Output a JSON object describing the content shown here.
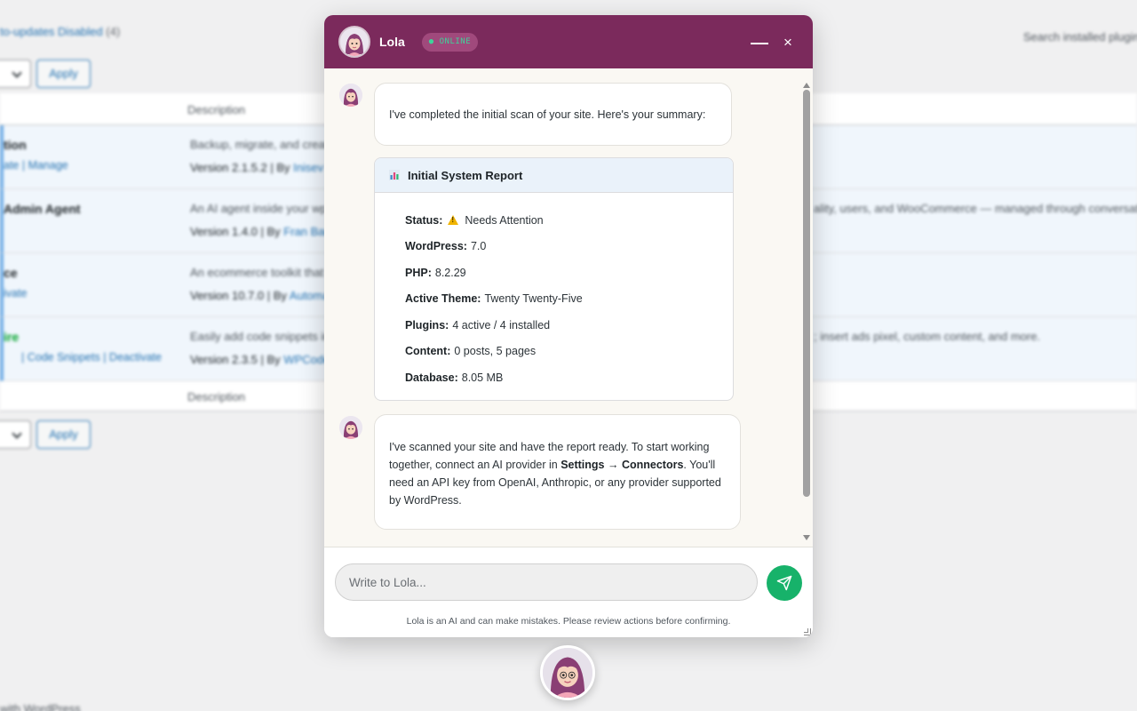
{
  "background": {
    "auto_updates": "to-updates Disabled",
    "auto_updates_count": "(4)",
    "search_label": "Search installed plugins",
    "apply_label": "Apply",
    "column_description": "Description",
    "rows": [
      {
        "name": "tion",
        "actions": "ate | Manage",
        "description": "Backup, migrate, and create",
        "version": "Version 2.1.5.2 | By",
        "author": "Inisev"
      },
      {
        "name": "Admin Agent",
        "actions": "",
        "description": "An AI agent inside your wp",
        "description_tail": "ality, users, and WooCommerce — managed through conversatio",
        "version": "Version 1.4.0 | By",
        "author": "Fran Barbe"
      },
      {
        "name": "ce",
        "actions": "ivate",
        "description": "An ecommerce toolkit that",
        "version": "Version 10.7.0 | By",
        "author": "Automat"
      },
      {
        "name": "ire",
        "actions": " | Code Snippets | Deactivate",
        "description": "Easily add code snippets in",
        "description_tail": "; insert ads pixel, custom content, and more.",
        "version": "Version 2.3.5 | By",
        "author": "WPCode"
      }
    ],
    "footer": "with WordPress"
  },
  "chat": {
    "agent_name": "Lola",
    "status": "● ONLINE",
    "minimize_icon": "minimize-icon",
    "close_label": "×",
    "messages": {
      "intro": "I've completed the initial scan of your site. Here's your summary:",
      "report": {
        "title": "Initial System Report",
        "icon": "bar-chart-icon",
        "items": [
          {
            "label": "Status:",
            "value": "Needs Attention",
            "icon": "warning-icon"
          },
          {
            "label": "WordPress:",
            "value": "7.0"
          },
          {
            "label": "PHP:",
            "value": "8.2.29"
          },
          {
            "label": "Active Theme:",
            "value": "Twenty Twenty-Five"
          },
          {
            "label": "Plugins:",
            "value": "4 active / 4 installed"
          },
          {
            "label": "Content:",
            "value": "0 posts, 5 pages"
          },
          {
            "label": "Database:",
            "value": "8.05 MB"
          }
        ]
      },
      "followup": {
        "part1": "I've scanned your site and have the report ready. To start working together, connect an AI provider in ",
        "settings_path": "Settings → Connectors",
        "part2": ". You'll need an API key from OpenAI, Anthropic, or any provider supported by WordPress."
      }
    },
    "input_placeholder": "Write to Lola...",
    "disclaimer": "Lola is an AI and can make mistakes. Please review actions before confirming.",
    "colors": {
      "header": "#7b2a5c",
      "online": "#3ed39a",
      "send": "#17b26a"
    }
  }
}
